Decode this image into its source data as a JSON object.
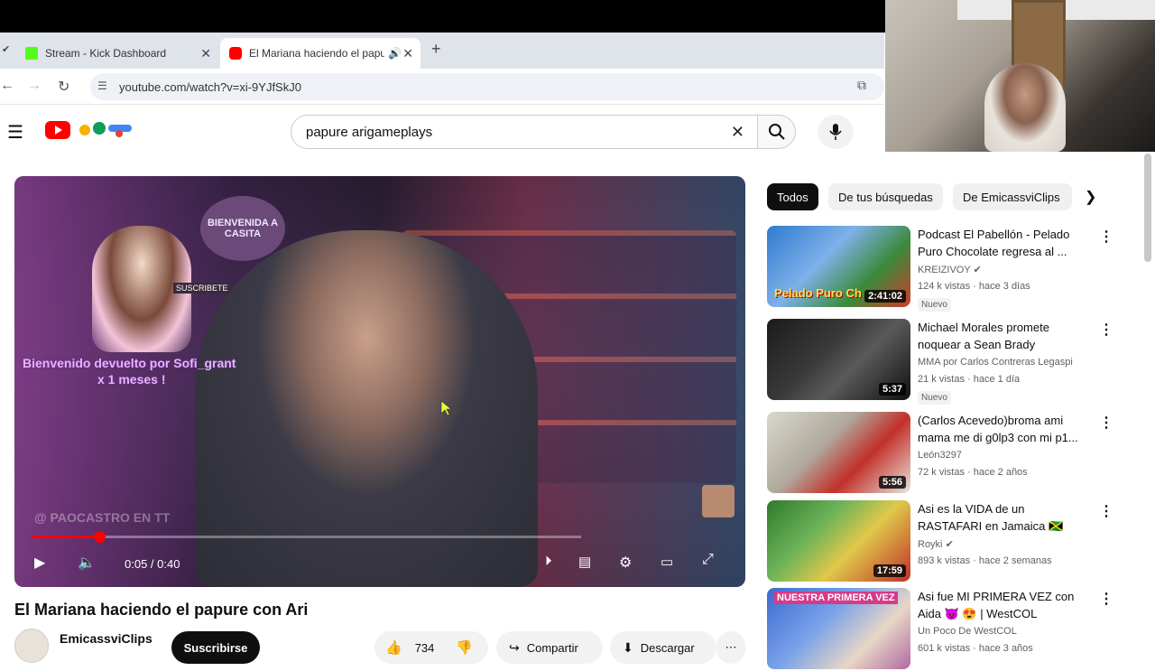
{
  "browser": {
    "tabs": [
      {
        "label": "Stream - Kick Dashboard",
        "favicon_color": "#53fc18"
      },
      {
        "label": "El Mariana haciendo el papu",
        "favicon_color": "#ff0000"
      }
    ],
    "new_tab": "+",
    "url": "youtube.com/watch?v=xi-9YJfSkJ0"
  },
  "youtube": {
    "search_value": "papure arigameplays",
    "video": {
      "title": "El Mariana haciendo el papure con Ari",
      "time": "0:05 / 0:40",
      "progress": 0.125,
      "overlay_welcome": "Bienvenido devuelto por Sofi_grant",
      "overlay_months": "x 1 meses !",
      "overlay_watermark": "@ PAOCASTRO EN TT",
      "overlay_sign": "BIENVENIDA A CASITA",
      "overlay_subscribe": "SUSCRIBETE"
    },
    "channel": {
      "name": "EmicassviClips",
      "subscribe_label": "Suscribirse"
    },
    "actions": {
      "likes": "734",
      "share": "Compartir",
      "download": "Descargar"
    },
    "chips": [
      "Todos",
      "De tus búsquedas",
      "De EmicassviClips"
    ],
    "recommendations": [
      {
        "title": "Podcast El Pabellón - Pelado Puro Chocolate regresa al ...",
        "channel": "KREIZIVOY",
        "verified": true,
        "meta": "124 k vistas · hace 3 días",
        "badge": "Nuevo",
        "duration": "2:41:02",
        "thumb_text": "Pelado Puro Ch"
      },
      {
        "title": "Michael Morales promete noquear a Sean Brady",
        "channel": "MMA por Carlos Contreras Legaspi",
        "verified": false,
        "meta": "21 k vistas · hace 1 día",
        "badge": "Nuevo",
        "duration": "5:37",
        "thumb_text": ""
      },
      {
        "title": "(Carlos Acevedo)broma ami mama me di g0lp3 con mi p1...",
        "channel": "León3297",
        "verified": false,
        "meta": "72 k vistas · hace 2 años",
        "badge": "",
        "duration": "5:56",
        "thumb_text": ""
      },
      {
        "title": "Asi es la VIDA de un RASTAFARI en Jamaica 🇯🇲",
        "channel": "Royki",
        "verified": true,
        "meta": "893 k vistas · hace 2 semanas",
        "badge": "",
        "duration": "17:59",
        "thumb_text": ""
      },
      {
        "title": "Asi fue MI PRIMERA VEZ con Aida 😈 😍 | WestCOL",
        "channel": "Un Poco De WestCOL",
        "verified": false,
        "meta": "601 k vistas · hace 3 años",
        "badge": "",
        "duration": "",
        "thumb_text": "NUESTRA PRIMERA VEZ"
      }
    ]
  },
  "colors": {
    "accent": "#ff0000",
    "chip_active": "#0f0f0f"
  }
}
